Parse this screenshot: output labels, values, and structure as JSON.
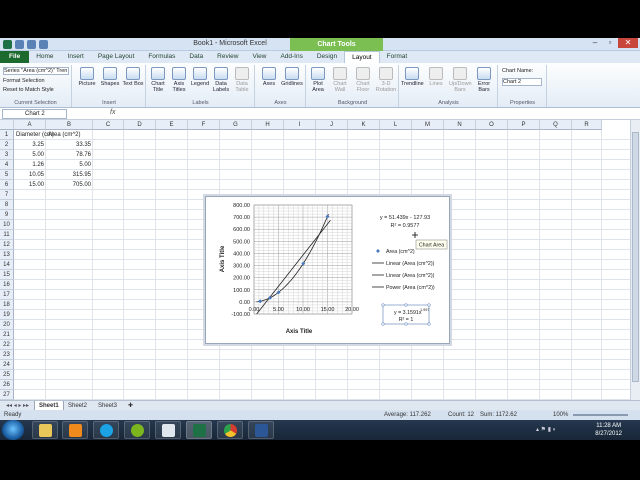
{
  "window": {
    "title": "Book1 - Microsoft Excel",
    "context_tab": "Chart Tools"
  },
  "tabs": [
    "File",
    "Home",
    "Insert",
    "Page Layout",
    "Formulas",
    "Data",
    "Review",
    "View",
    "Add-Ins",
    "Design",
    "Layout",
    "Format"
  ],
  "active_tab": "Layout",
  "ribbon": {
    "current_selection": {
      "dropdown": "Series \"Area (cm^2)\" Tren",
      "format_selection": "Format Selection",
      "reset": "Reset to Match Style",
      "label": "Current Selection"
    },
    "insert": {
      "buttons": [
        "Picture",
        "Shapes",
        "Text Box"
      ],
      "label": "Insert"
    },
    "labels": {
      "buttons": [
        "Chart Title",
        "Axis Titles",
        "Legend",
        "Data Labels",
        "Data Table"
      ],
      "label": "Labels"
    },
    "axes": {
      "buttons": [
        "Axes",
        "Gridlines"
      ],
      "label": "Axes"
    },
    "background": {
      "buttons": [
        "Plot Area",
        "Chart Wall",
        "Chart Floor",
        "3-D Rotation"
      ],
      "label": "Background"
    },
    "analysis": {
      "buttons": [
        "Trendline",
        "Lines",
        "Up/Down Bars",
        "Error Bars"
      ],
      "label": "Analysis"
    },
    "properties": {
      "chart_name_label": "Chart Name:",
      "chart_name": "Chart 2",
      "label": "Properties"
    }
  },
  "formula_bar": {
    "name_box": "Chart 2",
    "fx": "fx"
  },
  "columns": [
    "A",
    "B",
    "C",
    "D",
    "E",
    "F",
    "G",
    "H",
    "I",
    "J",
    "K",
    "L",
    "M",
    "N",
    "O",
    "P",
    "Q",
    "R"
  ],
  "rows": [
    "1",
    "2",
    "3",
    "4",
    "5",
    "6",
    "7",
    "8",
    "9",
    "10",
    "11",
    "12",
    "13",
    "14",
    "15",
    "16",
    "17",
    "18",
    "19",
    "20",
    "21",
    "22",
    "23",
    "24",
    "25",
    "26",
    "27"
  ],
  "table": {
    "headers": [
      "Diameter (cm)",
      "Area (cm^2)"
    ],
    "rows": [
      [
        "3.25",
        "33.35"
      ],
      [
        "5.00",
        "78.76"
      ],
      [
        "1.26",
        "5.00"
      ],
      [
        "10.05",
        "315.95"
      ],
      [
        "15.00",
        "705.00"
      ]
    ]
  },
  "chart_data": {
    "type": "scatter",
    "series": [
      {
        "name": "Area (cm^2)",
        "x": [
          3.25,
          5.0,
          1.26,
          10.05,
          15.0
        ],
        "y": [
          33.35,
          78.76,
          5.0,
          315.95,
          705.0
        ]
      }
    ],
    "xlabel": "Axis Title",
    "ylabel": "Axis Title",
    "xlim": [
      0,
      20
    ],
    "ylim": [
      -100,
      800
    ],
    "x_ticks": [
      "0.00",
      "5.00",
      "10.00",
      "15.00",
      "20.00"
    ],
    "y_ticks": [
      "-100.00",
      "0.00",
      "100.00",
      "200.00",
      "300.00",
      "400.00",
      "500.00",
      "600.00",
      "700.00",
      "800.00"
    ],
    "grid": true,
    "legend": [
      "Area (cm^2)",
      "Linear (Area (cm^2))",
      "Linear (Area (cm^2))",
      "Power (Area (cm^2))"
    ],
    "legend_position": "right",
    "linear_eq": "y = 51.439x - 127.93",
    "linear_r2": "R² = 0.9577",
    "power_eq": "y = 3.1591x",
    "power_exp": "1.997",
    "power_r2": "R² = 1",
    "tooltip": "Chart Area",
    "linear_fit": {
      "slope": 51.439,
      "intercept": -127.93
    },
    "power_fit": {
      "coef": 3.1591,
      "exp": 1.997
    }
  },
  "sheets": [
    "Sheet1",
    "Sheet2",
    "Sheet3"
  ],
  "status": {
    "ready": "Ready",
    "average": "Average: 117.262",
    "count": "Count: 12",
    "sum": "Sum: 1172.62",
    "zoom": "100%"
  },
  "taskbar": {
    "time": "11:28 AM",
    "date": "8/27/2012"
  },
  "colors": {
    "excel_green": "#1d6a2f",
    "chart_tools": "#7bbf53",
    "series": "#4a7bbf"
  }
}
